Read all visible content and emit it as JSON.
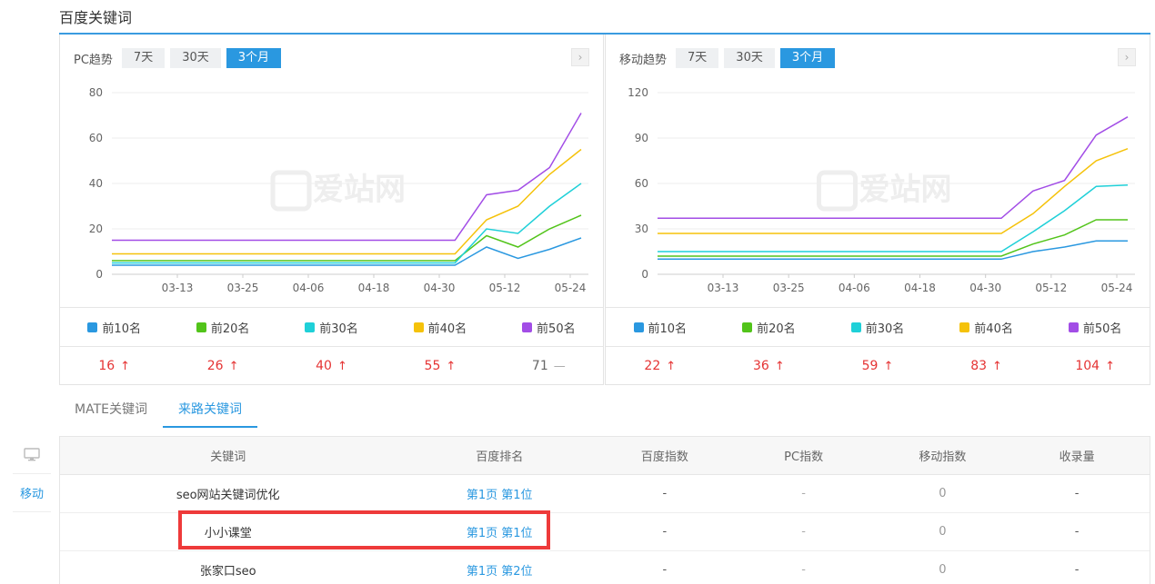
{
  "section": {
    "title": "百度关键词"
  },
  "pc_panel": {
    "label": "PC趋势",
    "ranges": [
      "7天",
      "30天",
      "3个月"
    ],
    "active_range": "3个月",
    "next_icon": "chevron-right-icon"
  },
  "mobile_panel": {
    "label": "移动趋势",
    "ranges": [
      "7天",
      "30天",
      "3个月"
    ],
    "active_range": "3个月",
    "next_icon": "chevron-right-icon"
  },
  "legend": [
    {
      "name": "前10名",
      "color": "#2a98e0"
    },
    {
      "name": "前20名",
      "color": "#52c41a"
    },
    {
      "name": "前30名",
      "color": "#1fd0d8"
    },
    {
      "name": "前40名",
      "color": "#f5c20a"
    },
    {
      "name": "前50名",
      "color": "#a24de6"
    }
  ],
  "pc_counts": [
    {
      "value": "16",
      "trend": "↑"
    },
    {
      "value": "26",
      "trend": "↑"
    },
    {
      "value": "40",
      "trend": "↑"
    },
    {
      "value": "55",
      "trend": "↑"
    },
    {
      "value": "71",
      "trend": "—"
    }
  ],
  "mobile_counts": [
    {
      "value": "22",
      "trend": "↑"
    },
    {
      "value": "36",
      "trend": "↑"
    },
    {
      "value": "59",
      "trend": "↑"
    },
    {
      "value": "83",
      "trend": "↑"
    },
    {
      "value": "104",
      "trend": "↑"
    }
  ],
  "chart_data": [
    {
      "type": "line",
      "title": "",
      "categories": [
        "03-13",
        "03-25",
        "04-06",
        "04-18",
        "04-30",
        "05-12",
        "05-24"
      ],
      "ylim": [
        0,
        80
      ],
      "yticks": [
        "0",
        "20",
        "40",
        "60",
        "80"
      ],
      "grid": true,
      "series": [
        {
          "name": "前10名",
          "color": "#2a98e0",
          "values": [
            4,
            4,
            4,
            4,
            4,
            4,
            4,
            12,
            7,
            11,
            16
          ]
        },
        {
          "name": "前20名",
          "color": "#52c41a",
          "values": [
            6,
            6,
            6,
            6,
            6,
            6,
            6,
            17,
            12,
            20,
            26
          ]
        },
        {
          "name": "前30名",
          "color": "#1fd0d8",
          "values": [
            5,
            5,
            5,
            5,
            5,
            5,
            5,
            20,
            18,
            30,
            40
          ]
        },
        {
          "name": "前40名",
          "color": "#f5c20a",
          "values": [
            9,
            9,
            9,
            9,
            9,
            9,
            9,
            24,
            30,
            44,
            55
          ]
        },
        {
          "name": "前50名",
          "color": "#a24de6",
          "values": [
            15,
            15,
            15,
            15,
            15,
            15,
            15,
            35,
            37,
            47,
            71
          ]
        }
      ]
    },
    {
      "type": "line",
      "title": "",
      "categories": [
        "03-13",
        "03-25",
        "04-06",
        "04-18",
        "04-30",
        "05-12",
        "05-24"
      ],
      "ylim": [
        0,
        120
      ],
      "yticks": [
        "0",
        "30",
        "60",
        "90",
        "120"
      ],
      "grid": true,
      "series": [
        {
          "name": "前10名",
          "color": "#2a98e0",
          "values": [
            10,
            10,
            10,
            10,
            10,
            10,
            10,
            15,
            18,
            22,
            22
          ]
        },
        {
          "name": "前20名",
          "color": "#52c41a",
          "values": [
            12,
            12,
            12,
            12,
            12,
            12,
            12,
            20,
            26,
            36,
            36
          ]
        },
        {
          "name": "前30名",
          "color": "#1fd0d8",
          "values": [
            15,
            15,
            15,
            15,
            15,
            15,
            15,
            28,
            42,
            58,
            59
          ]
        },
        {
          "name": "前40名",
          "color": "#f5c20a",
          "values": [
            27,
            27,
            27,
            27,
            27,
            27,
            27,
            40,
            58,
            75,
            83
          ]
        },
        {
          "name": "前50名",
          "color": "#a24de6",
          "values": [
            37,
            37,
            37,
            37,
            37,
            37,
            37,
            55,
            62,
            92,
            104
          ]
        }
      ]
    }
  ],
  "watermark": {
    "text": "爱站网",
    "icon": "aizhan-logo-icon"
  },
  "tabs": [
    "MATE关键词",
    "来路关键词"
  ],
  "active_tab": "来路关键词",
  "side_nav": {
    "desktop_icon": "monitor-icon",
    "mobile_label": "移动"
  },
  "table": {
    "headers": [
      "关键词",
      "百度排名",
      "百度指数",
      "PC指数",
      "移动指数",
      "收录量"
    ],
    "rows": [
      {
        "keyword": "seo网站关键词优化",
        "rank": "第1页 第1位",
        "baidu_index": "-",
        "pc_index": "-",
        "mobile_index": "0",
        "indexed": "-"
      },
      {
        "keyword": "小小课堂",
        "rank": "第1页 第1位",
        "baidu_index": "-",
        "pc_index": "-",
        "mobile_index": "0",
        "indexed": "-"
      },
      {
        "keyword": "张家口seo",
        "rank": "第1页 第2位",
        "baidu_index": "-",
        "pc_index": "-",
        "mobile_index": "0",
        "indexed": "-"
      }
    ]
  }
}
